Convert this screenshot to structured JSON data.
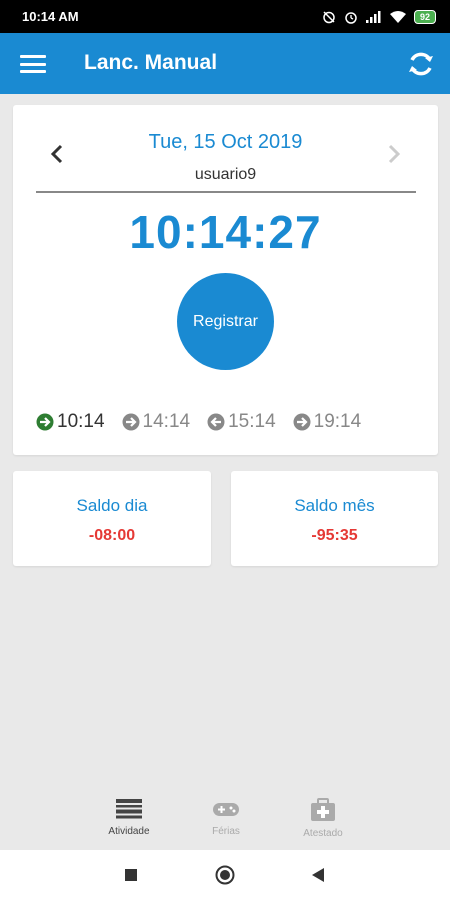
{
  "status_bar": {
    "time": "10:14 AM",
    "battery": "92"
  },
  "app_bar": {
    "title": "Lanc. Manual",
    "menu_icon": "hamburger-menu-icon",
    "refresh_icon": "refresh-icon"
  },
  "card": {
    "date": "Tue, 15 Oct 2019",
    "user": "usuario9",
    "clock": "10:14:27",
    "register_label": "Registrar",
    "punches": [
      {
        "time": "10:14",
        "direction": "in"
      },
      {
        "time": "14:14",
        "direction": "in"
      },
      {
        "time": "15:14",
        "direction": "out"
      },
      {
        "time": "19:14",
        "direction": "in"
      }
    ]
  },
  "saldo": {
    "day_label": "Saldo dia",
    "day_value": "-08:00",
    "month_label": "Saldo mês",
    "month_value": "-95:35"
  },
  "bottom_nav": [
    {
      "label": "Atividade",
      "icon": "list-icon",
      "active": true
    },
    {
      "label": "Férias",
      "icon": "gamepad-icon",
      "active": false
    },
    {
      "label": "Atestado",
      "icon": "medical-kit-icon",
      "active": false
    }
  ],
  "colors": {
    "primary": "#1a8ad2",
    "negative": "#e53935",
    "punch_active": "#2e7d32"
  }
}
